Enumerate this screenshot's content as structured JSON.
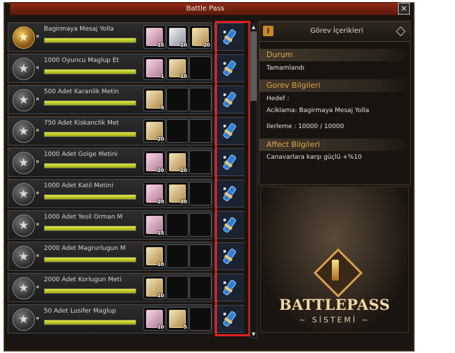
{
  "window": {
    "title": "Battle Pass",
    "close_glyph": "✕"
  },
  "quests": [
    {
      "name": "Bagirmaya Mesaj Yolla",
      "medal": "gold",
      "progress": 1.0,
      "rewards": [
        {
          "type": "pink",
          "count": "15"
        },
        {
          "type": "silver",
          "count": "10"
        },
        {
          "type": "beige",
          "count": "20"
        }
      ]
    },
    {
      "name": "1000 Oyuncu Maglup Et",
      "medal": "silver",
      "progress": 1.0,
      "rewards": [
        {
          "type": "pink",
          "count": "1"
        },
        {
          "type": "beige",
          "count": "10"
        }
      ]
    },
    {
      "name": "500 Adet Karanlik Metin",
      "medal": "silver",
      "progress": 1.0,
      "rewards": [
        {
          "type": "beige",
          "count": "5"
        }
      ]
    },
    {
      "name": "750 Adet Kiskanclik Met",
      "medal": "silver",
      "progress": 1.0,
      "rewards": [
        {
          "type": "beige",
          "count": "20"
        }
      ]
    },
    {
      "name": "1000 Adet Golge Metini",
      "medal": "silver",
      "progress": 1.0,
      "rewards": [
        {
          "type": "pink",
          "count": "20"
        },
        {
          "type": "beige",
          "count": "20"
        }
      ]
    },
    {
      "name": "1000 Adet Katil Metini",
      "medal": "silver",
      "progress": 1.0,
      "rewards": [
        {
          "type": "pink",
          "count": "20"
        },
        {
          "type": "beige",
          "count": "30"
        }
      ]
    },
    {
      "name": "1000 Adet Yesil Orman M",
      "medal": "silver",
      "progress": 1.0,
      "rewards": [
        {
          "type": "pink",
          "count": "15"
        }
      ]
    },
    {
      "name": "2000 Adet Magrurlugun M",
      "medal": "silver",
      "progress": 1.0,
      "rewards": [
        {
          "type": "beige",
          "count": "10"
        }
      ]
    },
    {
      "name": "2000 Adet Korlugun Meti",
      "medal": "silver",
      "progress": 1.0,
      "rewards": [
        {
          "type": "beige",
          "count": "10"
        }
      ]
    },
    {
      "name": "50 Adet Lusifer Maglup",
      "medal": "silver",
      "progress": 1.0,
      "rewards": [
        {
          "type": "pink",
          "count": "10"
        },
        {
          "type": "beige",
          "count": "5"
        }
      ]
    }
  ],
  "detail": {
    "header": "Görev İçerikleri",
    "status_title": "Durum",
    "status_value": "Tamamlandı",
    "info_title": "Gorev Bilgileri",
    "target_label": "Hedef :",
    "description": "Aciklama: Bagirmaya Mesaj Yolla",
    "progress_text": "Ilerleme : 10000 / 10000",
    "affect_title": "Affect Bilgileri",
    "affect_value": "Canavarlara karşı güçlü +%10"
  },
  "banner": {
    "title": "BATTLEPASS",
    "subtitle": "~ SİSTEMİ ~"
  },
  "colors": {
    "accent": "#e3a74a",
    "highlight": "#e21f1f",
    "progress": "#d8e02c"
  }
}
